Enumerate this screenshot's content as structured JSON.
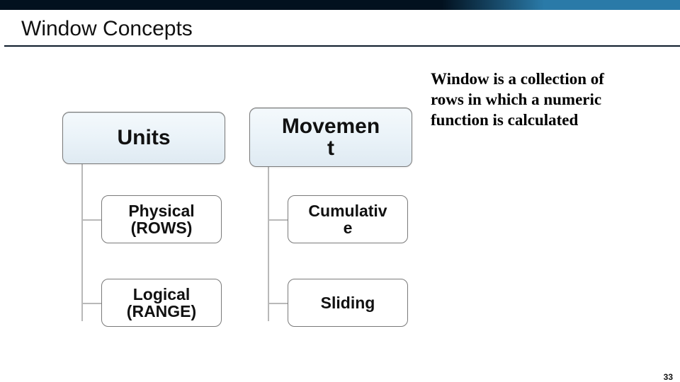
{
  "slide": {
    "title": "Window Concepts",
    "caption": "Window is a collection of rows in which a numeric function is calculated",
    "page_number": "33"
  },
  "diagram": {
    "left": {
      "parent": "Units",
      "children": [
        "Physical (ROWS)",
        "Logical (RANGE)"
      ]
    },
    "right": {
      "parent": "Movemen\nt",
      "children": [
        "Cumulativ\ne",
        "Sliding"
      ]
    }
  }
}
